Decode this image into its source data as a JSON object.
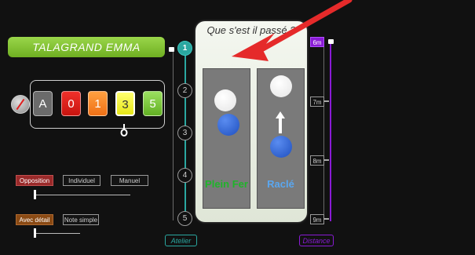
{
  "student": {
    "name": "TALAGRAND  EMMA"
  },
  "grades": {
    "buttons": [
      {
        "label": "A"
      },
      {
        "label": "0"
      },
      {
        "label": "1"
      },
      {
        "label": "3"
      },
      {
        "label": "5"
      }
    ],
    "selected": "3"
  },
  "mode_toggles": {
    "opposition": "Opposition",
    "individuel": "Individuel",
    "manuel": "Manuel",
    "avec_detail": "Avec détail",
    "note_simple": "Note simple"
  },
  "atelier": {
    "label": "Atelier",
    "steps": [
      "1",
      "2",
      "3",
      "4",
      "5"
    ],
    "selected": "1"
  },
  "question": {
    "title": "Que s'est il passé ?",
    "options": [
      {
        "label": "Plein Fer",
        "color": "#1fb42a"
      },
      {
        "label": "Raclé",
        "color": "#5aa7f0"
      }
    ]
  },
  "distance": {
    "label": "Distance",
    "marks": [
      "6m",
      "7m",
      "8m",
      "9m"
    ],
    "selected": "6m"
  },
  "colors": {
    "accent_teal": "#2aa7a0",
    "accent_purple": "#8a1bd6",
    "name_green": "#8bc83a"
  }
}
